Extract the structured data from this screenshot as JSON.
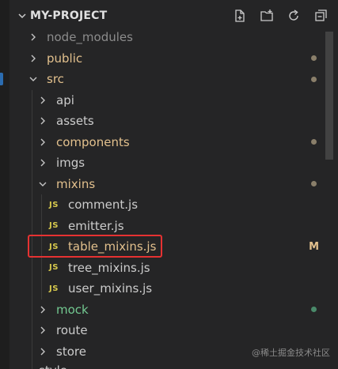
{
  "explorer": {
    "title": "MY-PROJECT",
    "actions": [
      {
        "name": "new-file-icon"
      },
      {
        "name": "new-folder-icon"
      },
      {
        "name": "refresh-icon"
      },
      {
        "name": "collapse-all-icon"
      }
    ]
  },
  "tree": [
    {
      "type": "folder",
      "label": "node_modules",
      "depth": 0,
      "expanded": false,
      "color": "#8c8c8c",
      "status": null
    },
    {
      "type": "folder",
      "label": "public",
      "depth": 0,
      "expanded": false,
      "color": "#e2c08d",
      "status": "dot",
      "status_color": "#8a7f6a"
    },
    {
      "type": "folder",
      "label": "src",
      "depth": 0,
      "expanded": true,
      "color": "#e2c08d",
      "status": "dot",
      "status_color": "#8a7f6a"
    },
    {
      "type": "folder",
      "label": "api",
      "depth": 1,
      "expanded": false,
      "color": "#cccccc",
      "status": null
    },
    {
      "type": "folder",
      "label": "assets",
      "depth": 1,
      "expanded": false,
      "color": "#cccccc",
      "status": null
    },
    {
      "type": "folder",
      "label": "components",
      "depth": 1,
      "expanded": false,
      "color": "#e2c08d",
      "status": "dot",
      "status_color": "#8a7f6a"
    },
    {
      "type": "folder",
      "label": "imgs",
      "depth": 1,
      "expanded": false,
      "color": "#cccccc",
      "status": null
    },
    {
      "type": "folder",
      "label": "mixins",
      "depth": 1,
      "expanded": true,
      "color": "#e2c08d",
      "status": "dot",
      "status_color": "#8a7f6a"
    },
    {
      "type": "file",
      "label": "comment.js",
      "badge": "JS",
      "depth": 2,
      "color": "#cccccc",
      "status": null
    },
    {
      "type": "file",
      "label": "emitter.js",
      "badge": "JS",
      "depth": 2,
      "color": "#cccccc",
      "status": null
    },
    {
      "type": "file",
      "label": "table_mixins.js",
      "badge": "JS",
      "depth": 2,
      "color": "#e2c08d",
      "status": "letter",
      "status_text": "M",
      "status_color": "#e2c08d",
      "highlighted": true
    },
    {
      "type": "file",
      "label": "tree_mixins.js",
      "badge": "JS",
      "depth": 2,
      "color": "#cccccc",
      "status": null
    },
    {
      "type": "file",
      "label": "user_mixins.js",
      "badge": "JS",
      "depth": 2,
      "color": "#cccccc",
      "status": null
    },
    {
      "type": "folder",
      "label": "mock",
      "depth": 1,
      "expanded": false,
      "color": "#73c991",
      "status": "dot",
      "status_color": "#4a8a6a"
    },
    {
      "type": "folder",
      "label": "route",
      "depth": 1,
      "expanded": false,
      "color": "#cccccc",
      "status": null
    },
    {
      "type": "folder",
      "label": "store",
      "depth": 1,
      "expanded": false,
      "color": "#cccccc",
      "status": null
    }
  ],
  "partial_row_label": "style",
  "watermark": "@稀土掘金技术社区",
  "colors": {
    "background": "#252526",
    "highlight_border": "#e63232",
    "js_badge": "#d7c94d"
  }
}
